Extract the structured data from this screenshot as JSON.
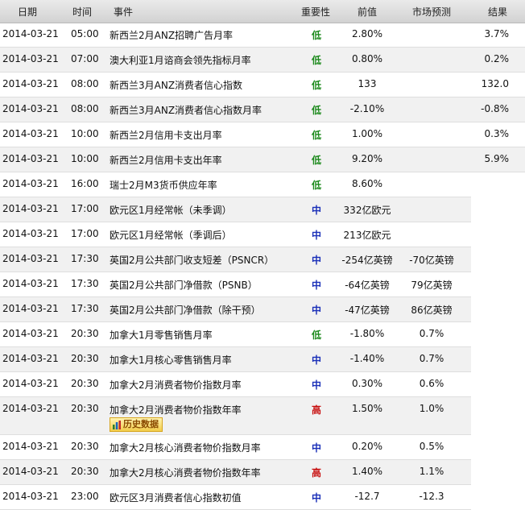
{
  "headers": {
    "date": "日期",
    "time": "时间",
    "event": "事件",
    "importance": "重要性",
    "previous": "前值",
    "forecast": "市场预测",
    "actual": "结果"
  },
  "history_button_label": "历史数据",
  "importance_colors": {
    "低": "#1c8a1c",
    "中": "#1a2fb8",
    "高": "#c81010"
  },
  "rows": [
    {
      "date": "2014-03-21",
      "time": "05:00",
      "event": "新西兰2月ANZ招聘广告月率",
      "importance": "低",
      "previous": "2.80%",
      "forecast": "",
      "actual": "3.7%"
    },
    {
      "date": "2014-03-21",
      "time": "07:00",
      "event": "澳大利亚1月谘商会领先指标月率",
      "importance": "低",
      "previous": "0.80%",
      "forecast": "",
      "actual": "0.2%"
    },
    {
      "date": "2014-03-21",
      "time": "08:00",
      "event": "新西兰3月ANZ消费者信心指数",
      "importance": "低",
      "previous": "133",
      "forecast": "",
      "actual": "132.0"
    },
    {
      "date": "2014-03-21",
      "time": "08:00",
      "event": "新西兰3月ANZ消费者信心指数月率",
      "importance": "低",
      "previous": "-2.10%",
      "forecast": "",
      "actual": "-0.8%"
    },
    {
      "date": "2014-03-21",
      "time": "10:00",
      "event": "新西兰2月信用卡支出月率",
      "importance": "低",
      "previous": "1.00%",
      "forecast": "",
      "actual": "0.3%"
    },
    {
      "date": "2014-03-21",
      "time": "10:00",
      "event": "新西兰2月信用卡支出年率",
      "importance": "低",
      "previous": "9.20%",
      "forecast": "",
      "actual": "5.9%"
    },
    {
      "date": "2014-03-21",
      "time": "16:00",
      "event": "瑞士2月M3货币供应年率",
      "importance": "低",
      "previous": "8.60%",
      "forecast": "",
      "actual": ""
    },
    {
      "date": "2014-03-21",
      "time": "17:00",
      "event": "欧元区1月经常帐（未季调）",
      "importance": "中",
      "previous": "332亿欧元",
      "forecast": "",
      "actual": ""
    },
    {
      "date": "2014-03-21",
      "time": "17:00",
      "event": "欧元区1月经常帐（季调后）",
      "importance": "中",
      "previous": "213亿欧元",
      "forecast": "",
      "actual": ""
    },
    {
      "date": "2014-03-21",
      "time": "17:30",
      "event": "英国2月公共部门收支短差（PSNCR）",
      "importance": "中",
      "previous": "-254亿英镑",
      "forecast": "-70亿英镑",
      "actual": ""
    },
    {
      "date": "2014-03-21",
      "time": "17:30",
      "event": "英国2月公共部门净借款（PSNB）",
      "importance": "中",
      "previous": "-64亿英镑",
      "forecast": "79亿英镑",
      "actual": ""
    },
    {
      "date": "2014-03-21",
      "time": "17:30",
      "event": "英国2月公共部门净借款（除干预）",
      "importance": "中",
      "previous": "-47亿英镑",
      "forecast": "86亿英镑",
      "actual": ""
    },
    {
      "date": "2014-03-21",
      "time": "20:30",
      "event": "加拿大1月零售销售月率",
      "importance": "低",
      "previous": "-1.80%",
      "forecast": "0.7%",
      "actual": ""
    },
    {
      "date": "2014-03-21",
      "time": "20:30",
      "event": "加拿大1月核心零售销售月率",
      "importance": "中",
      "previous": "-1.40%",
      "forecast": "0.7%",
      "actual": ""
    },
    {
      "date": "2014-03-21",
      "time": "20:30",
      "event": "加拿大2月消费者物价指数月率",
      "importance": "中",
      "previous": "0.30%",
      "forecast": "0.6%",
      "actual": ""
    },
    {
      "date": "2014-03-21",
      "time": "20:30",
      "event": "加拿大2月消费者物价指数年率",
      "importance": "高",
      "previous": "1.50%",
      "forecast": "1.0%",
      "actual": "",
      "history": true
    },
    {
      "date": "2014-03-21",
      "time": "20:30",
      "event": "加拿大2月核心消费者物价指数月率",
      "importance": "中",
      "previous": "0.20%",
      "forecast": "0.5%",
      "actual": ""
    },
    {
      "date": "2014-03-21",
      "time": "20:30",
      "event": "加拿大2月核心消费者物价指数年率",
      "importance": "高",
      "previous": "1.40%",
      "forecast": "1.1%",
      "actual": ""
    },
    {
      "date": "2014-03-21",
      "time": "23:00",
      "event": "欧元区3月消费者信心指数初值",
      "importance": "中",
      "previous": "-12.7",
      "forecast": "-12.3",
      "actual": ""
    }
  ]
}
